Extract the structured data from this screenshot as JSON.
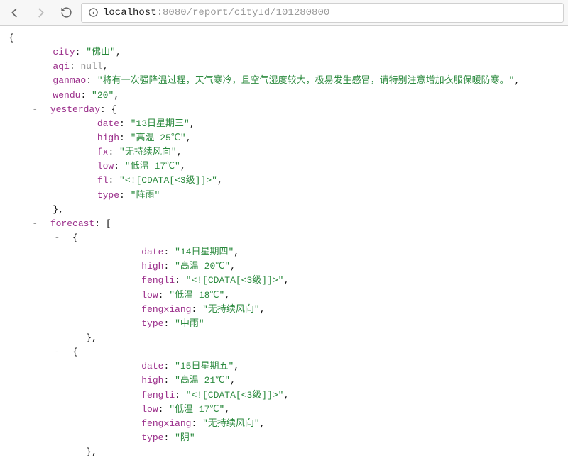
{
  "url": {
    "prefix": "localhost",
    "rest": ":8080/report/cityId/101280800"
  },
  "chart_data": {
    "type": "table",
    "title": "JSON response",
    "data": {
      "city": "佛山",
      "aqi": null,
      "ganmao": "将有一次强降温过程，天气寒冷，且空气湿度较大，极易发生感冒，请特别注意增加衣服保暖防寒。",
      "wendu": "20",
      "yesterday": {
        "date": "13日星期三",
        "high": "高温 25℃",
        "fx": "无持续风向",
        "low": "低温 17℃",
        "fl": "<![CDATA[<3级]]>",
        "type": "阵雨"
      },
      "forecast": [
        {
          "date": "14日星期四",
          "high": "高温 20℃",
          "fengli": "<![CDATA[<3级]]>",
          "low": "低温 18℃",
          "fengxiang": "无持续风向",
          "type": "中雨"
        },
        {
          "date": "15日星期五",
          "high": "高温 21℃",
          "fengli": "<![CDATA[<3级]]>",
          "low": "低温 17℃",
          "fengxiang": "无持续风向",
          "type": "阴"
        }
      ]
    }
  },
  "toggle": "-"
}
